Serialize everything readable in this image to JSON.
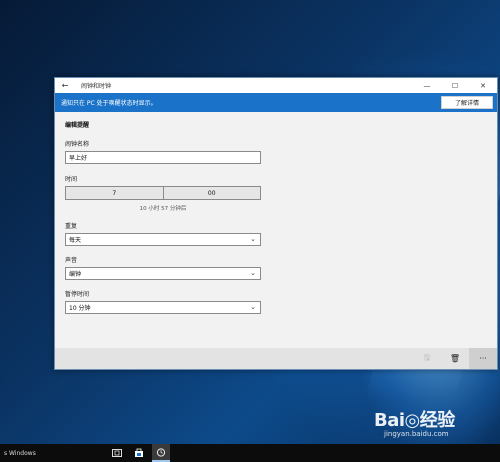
{
  "window": {
    "title": "闹钟和时钟",
    "back_icon": "←",
    "minimize_icon": "—",
    "maximize_icon": "☐",
    "close_icon": "✕"
  },
  "notice": {
    "text": "通知只在 PC 处于唤醒状态时显示。",
    "button_label": "了解详情"
  },
  "form": {
    "section_title": "编辑提醒",
    "name_label": "闹钟名称",
    "name_value": "早上好",
    "time_label": "时间",
    "hour": "7",
    "minute": "00",
    "time_note": "10 小时 57 分钟后",
    "repeat_label": "重复",
    "repeat_value": "每天",
    "sound_label": "声音",
    "sound_value": "编钟",
    "snooze_label": "暂停时间",
    "snooze_value": "10 分钟",
    "chevron": "⌄"
  },
  "bottom_bar": {
    "save_icon": "🖫",
    "delete_icon": "🗑",
    "more_icon": "···"
  },
  "taskbar": {
    "start_text": "s Windows"
  },
  "watermark": {
    "logo": "Bai◎经验",
    "url": "jingyan.baidu.com"
  }
}
